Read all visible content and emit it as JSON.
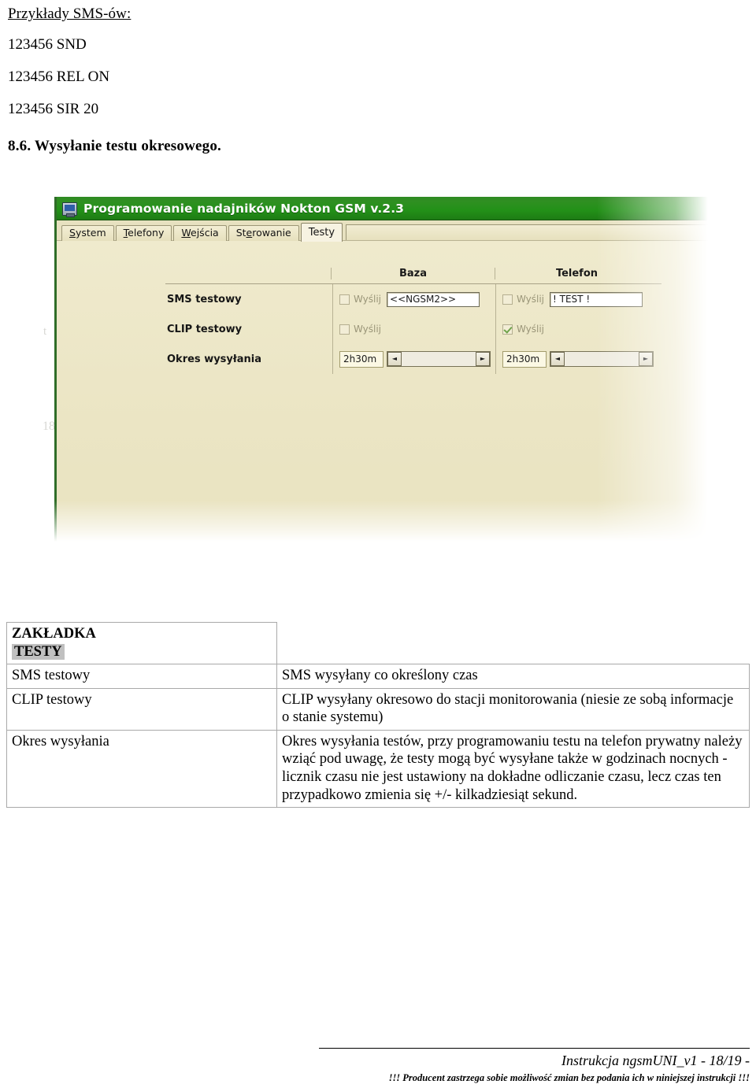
{
  "document": {
    "sms_examples_heading": "Przykłady SMS-ów:",
    "sms_examples": [
      "123456 SND",
      "123456 REL ON",
      "123456 SIR 20"
    ],
    "section_heading": "8.6. Wysyłanie testu okresowego."
  },
  "app_window": {
    "title": "Programowanie nadajników Nokton GSM v.2.3",
    "title_icon": "computer-icon",
    "title_bar_color": "#2b8c1f",
    "background_color": "#ece6c6",
    "tabs": [
      {
        "label": "System",
        "mnemonic": "S",
        "active": false
      },
      {
        "label": "Telefony",
        "mnemonic": "T",
        "active": false
      },
      {
        "label": "Wejścia",
        "mnemonic": "W",
        "active": false
      },
      {
        "label": "Sterowanie",
        "mnemonic": "e",
        "active": false
      },
      {
        "label": "Testy",
        "mnemonic": "",
        "active": true
      }
    ],
    "form": {
      "column_headers": [
        "Baza",
        "Telefon"
      ],
      "rows": [
        {
          "label": "SMS testowy",
          "baza": {
            "checkbox_label": "Wyślij",
            "checked": false,
            "text_value": "<<NGSM2>>"
          },
          "telefon": {
            "checkbox_label": "Wyślij",
            "checked": false,
            "text_value": "! TEST !"
          }
        },
        {
          "label": "CLIP testowy",
          "baza": {
            "checkbox_label": "Wyślij",
            "checked": false,
            "text_value": null
          },
          "telefon": {
            "checkbox_label": "Wyślij",
            "checked": true,
            "text_value": null
          }
        },
        {
          "label": "Okres wysyłania",
          "baza": {
            "checkbox_label": null,
            "checked": null,
            "spinner_value": "2h30m"
          },
          "telefon": {
            "checkbox_label": null,
            "checked": null,
            "spinner_value": "2h30m"
          }
        }
      ],
      "spinner_left_arrow": "◄",
      "spinner_right_arrow": "►"
    },
    "ghost_artifacts": [
      "t",
      "18"
    ]
  },
  "description_table": {
    "header": {
      "line1": "ZAKŁADKA",
      "line2": "TESTY",
      "line2_highlighted": true,
      "highlight_color": "#c0c0c0"
    },
    "rows": [
      {
        "term": "SMS testowy",
        "definition": "SMS wysyłany co określony czas"
      },
      {
        "term": "CLIP testowy",
        "definition": "CLIP wysyłany okresowo do stacji monitorowania (niesie ze sobą informacje o stanie systemu)"
      },
      {
        "term": "Okres wysyłania",
        "definition": "Okres wysyłania testów, przy programowaniu testu na telefon prywatny należy wziąć pod uwagę, że testy mogą być wysyłane także w godzinach nocnych - licznik czasu nie jest ustawiony na dokładne odliczanie czasu, lecz czas ten przypadkowo zmienia się +/- kilkadziesiąt sekund."
      }
    ]
  },
  "footer": {
    "main": "Instrukcja ngsmUNI_v1 - 18/19 -",
    "disclaimer": "!!! Producent zastrzega sobie możliwość zmian bez podania ich w niniejszej instrukcji !!!"
  }
}
